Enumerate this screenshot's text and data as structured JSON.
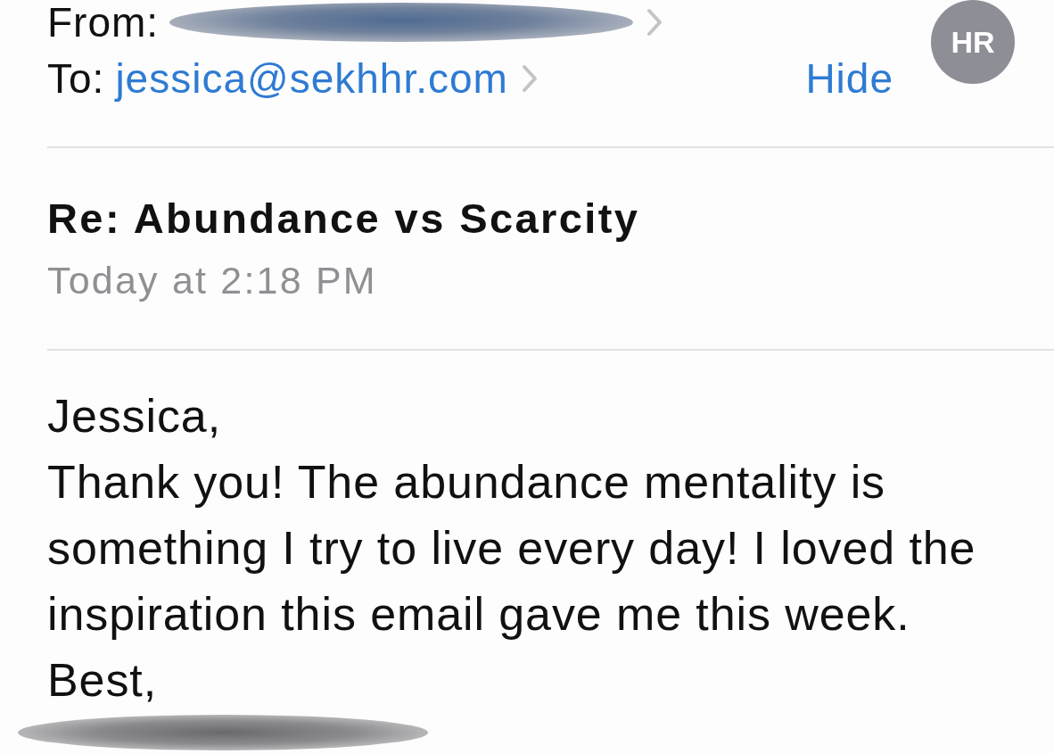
{
  "header": {
    "from_label": "From:",
    "to_label": "To:",
    "to_address": "jessica@sekhhr.com",
    "hide_link": "Hide",
    "avatar_initials": "HR"
  },
  "message": {
    "subject": "Re: Abundance vs Scarcity",
    "date": "Today at 2:18 PM",
    "body": [
      "Jessica,",
      "Thank you! The abundance mentality is something I try to live every day! I loved the inspiration this email gave me this week.",
      "Best,"
    ]
  }
}
